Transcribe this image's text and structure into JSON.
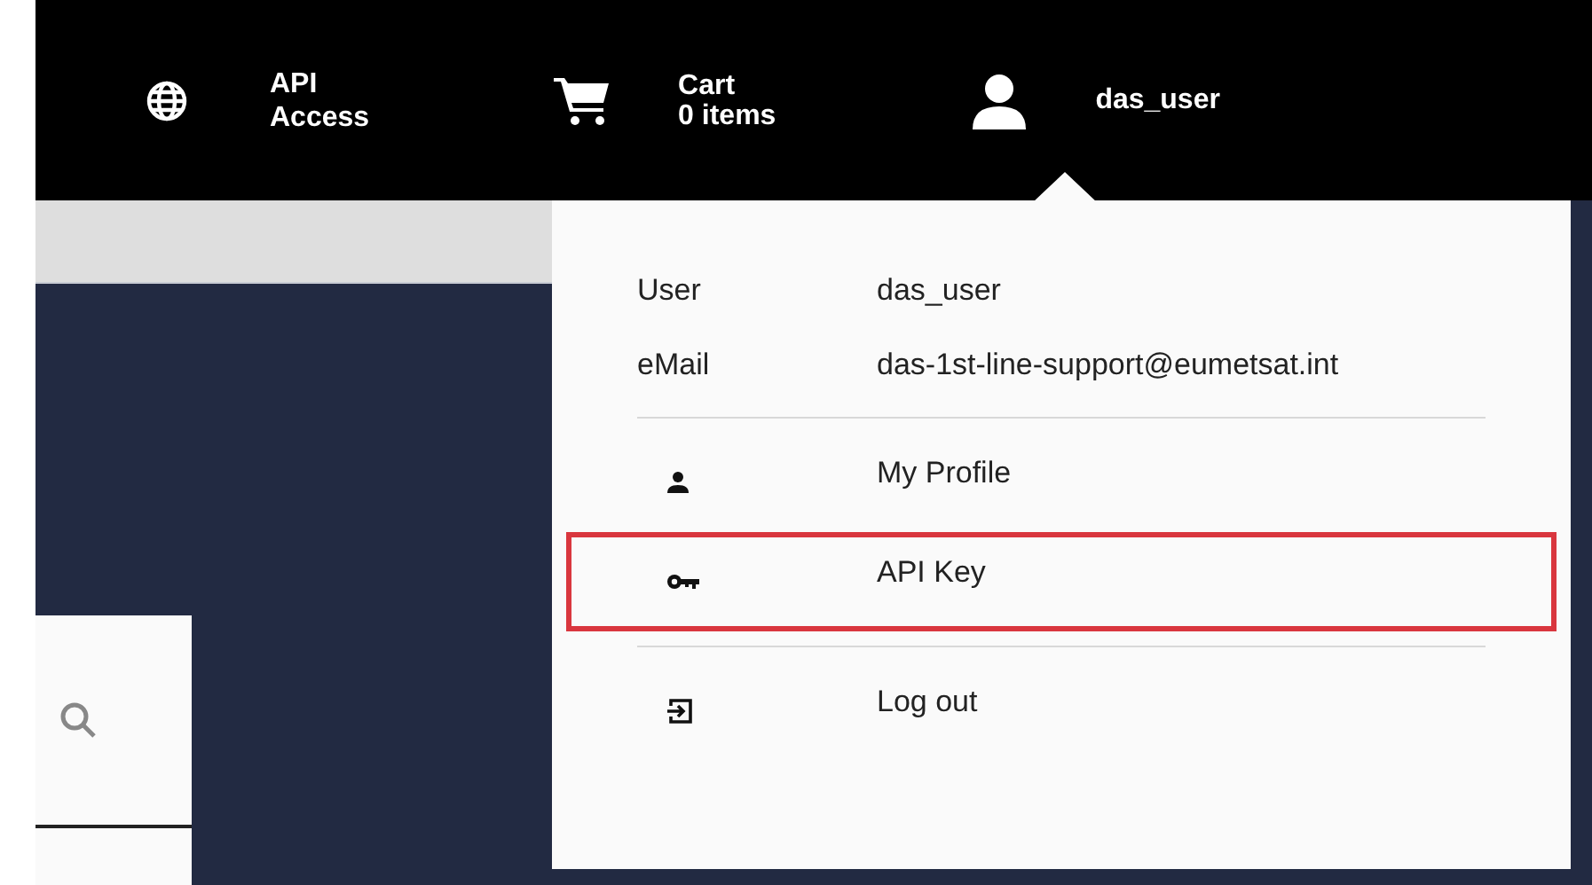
{
  "header": {
    "api_access": {
      "line_1": "API",
      "line_2": "Access"
    },
    "cart": {
      "title": "Cart",
      "count": "0 items"
    },
    "user": {
      "name": "das_user"
    }
  },
  "user_menu": {
    "info": [
      {
        "label": "User",
        "value": "das_user"
      },
      {
        "label": "eMail",
        "value": "das-1st-line-support@eumetsat.int"
      }
    ],
    "items": [
      {
        "kind": "profile",
        "label": "My Profile",
        "highlighted": false
      },
      {
        "kind": "key",
        "label": "API Key",
        "highlighted": true
      },
      {
        "kind": "logout",
        "label": "Log out",
        "highlighted": false
      }
    ]
  }
}
